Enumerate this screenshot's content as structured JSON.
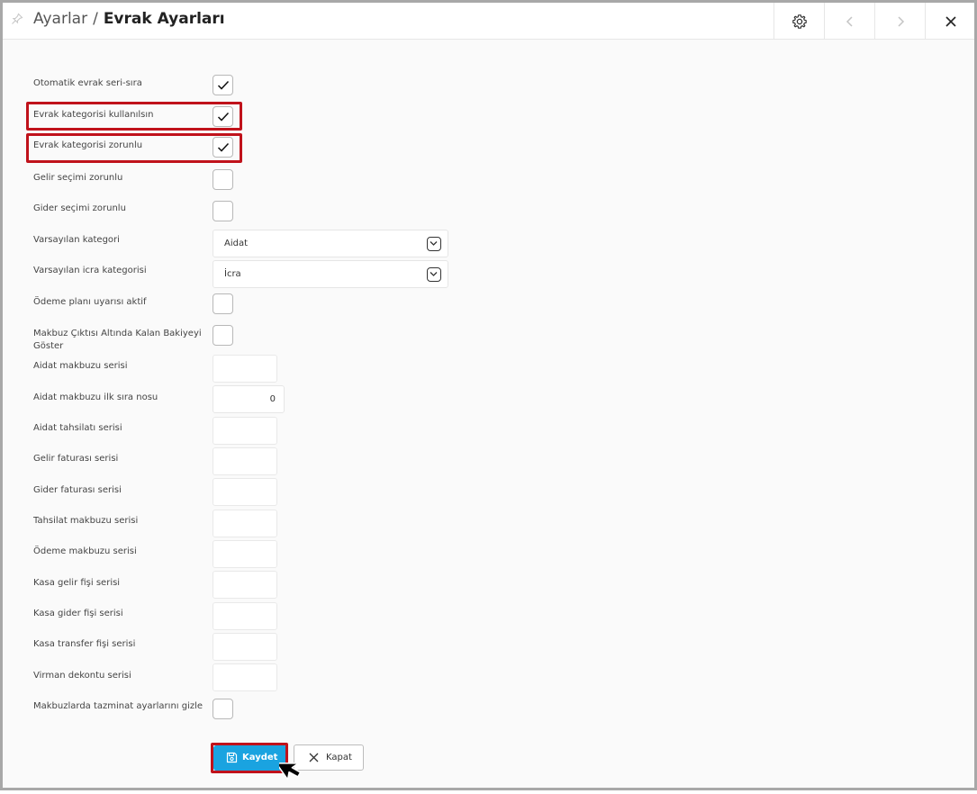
{
  "header": {
    "breadcrumb_parent": "Ayarlar",
    "breadcrumb_sep": "/",
    "breadcrumb_current": "Evrak Ayarları"
  },
  "toolbar_icons": [
    "pin-icon",
    "gear-icon",
    "chevron-left-icon",
    "chevron-right-icon",
    "close-icon"
  ],
  "form": {
    "auto_serial": {
      "label": "Otomatik evrak seri-sıra",
      "checked": true
    },
    "use_category": {
      "label": "Evrak kategorisi kullanılsın",
      "checked": true
    },
    "category_required": {
      "label": "Evrak kategorisi zorunlu",
      "checked": true
    },
    "income_required": {
      "label": "Gelir seçimi zorunlu",
      "checked": false
    },
    "expense_required": {
      "label": "Gider seçimi zorunlu",
      "checked": false
    },
    "default_category": {
      "label": "Varsayılan kategori",
      "value": "Aidat"
    },
    "default_icra_category": {
      "label": "Varsayılan icra kategorisi",
      "value": "İcra"
    },
    "payment_plan_warning": {
      "label": "Ödeme planı uyarısı aktif",
      "checked": false
    },
    "receipt_balance": {
      "label_line1": "Makbuz Çıktısı Altında Kalan Bakiyeyi",
      "label_line2": "Göster",
      "checked": false
    },
    "aidat_receipt_serial": {
      "label": "Aidat makbuzu serisi",
      "value": ""
    },
    "aidat_receipt_first_no": {
      "label": "Aidat makbuzu ilk sıra nosu",
      "value": "0"
    },
    "aidat_collection_serial": {
      "label": "Aidat tahsilatı serisi",
      "value": ""
    },
    "income_invoice_serial": {
      "label": "Gelir faturası serisi",
      "value": ""
    },
    "expense_invoice_serial": {
      "label": "Gider faturası serisi",
      "value": ""
    },
    "collection_receipt_serial": {
      "label": "Tahsilat makbuzu serisi",
      "value": ""
    },
    "payment_receipt_serial": {
      "label": "Ödeme makbuzu serisi",
      "value": ""
    },
    "cash_income_serial": {
      "label": "Kasa gelir fişi serisi",
      "value": ""
    },
    "cash_expense_serial": {
      "label": "Kasa gider fişi serisi",
      "value": ""
    },
    "cash_transfer_serial": {
      "label": "Kasa transfer fişi serisi",
      "value": ""
    },
    "virman_serial": {
      "label": "Virman dekontu serisi",
      "value": ""
    },
    "hide_compensation": {
      "label": "Makbuzlarda tazminat ayarlarını gizle",
      "checked": false
    }
  },
  "buttons": {
    "save_label": "Kaydet",
    "close_label": "Kapat"
  },
  "colors": {
    "highlight": "#c0121b",
    "primary": "#1aa3e0"
  }
}
